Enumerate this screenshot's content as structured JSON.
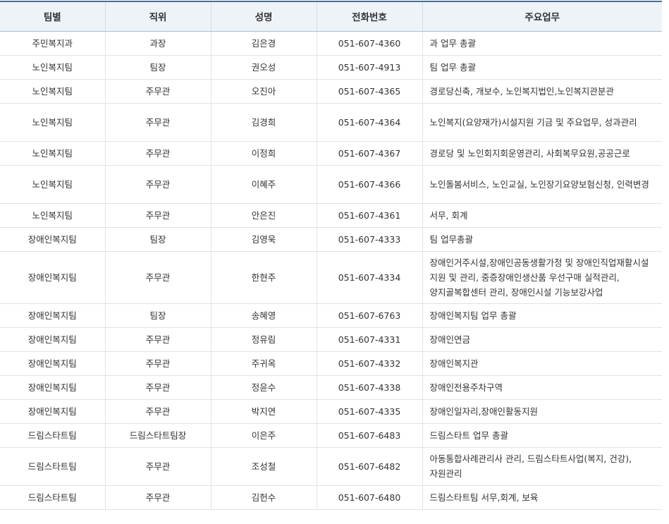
{
  "table": {
    "headers": [
      "팀별",
      "직위",
      "성명",
      "전화번호",
      "주요업무"
    ],
    "rows": [
      {
        "team": "주민복지과",
        "position": "과장",
        "name": "김은경",
        "phone": "051-607-4360",
        "duty": "과 업무 총괄"
      },
      {
        "team": "노인복지팀",
        "position": "팀장",
        "name": "권오성",
        "phone": "051-607-4913",
        "duty": "팀 업무 총괄"
      },
      {
        "team": "노인복지팀",
        "position": "주무관",
        "name": "오진아",
        "phone": "051-607-4365",
        "duty": "경로당신축, 개보수, 노인복지법인,노인복지관분관"
      },
      {
        "team": "노인복지팀",
        "position": "주무관",
        "name": "김경희",
        "phone": "051-607-4364",
        "duty": "노인복지(요양재가)시설지원 기금 및 주요업무, 성과관리"
      },
      {
        "team": "노인복지팀",
        "position": "주무관",
        "name": "이정희",
        "phone": "051-607-4367",
        "duty": "경로당 및 노인회지회운영관리, 사회복무요원,공공근로"
      },
      {
        "team": "노인복지팀",
        "position": "주무관",
        "name": "이혜주",
        "phone": "051-607-4366",
        "duty": "노인돌봄서비스, 노인교실, 노인장기요양보험신청, 인력변경"
      },
      {
        "team": "노인복지팀",
        "position": "주무관",
        "name": "안은진",
        "phone": "051-607-4361",
        "duty": "서무, 회계"
      },
      {
        "team": "장애인복지팀",
        "position": "팀장",
        "name": "김영욱",
        "phone": "051-607-4333",
        "duty": "팀 업무총괄"
      },
      {
        "team": "장애인복지팀",
        "position": "주무관",
        "name": "한현주",
        "phone": "051-607-4334",
        "duty": "장애인거주시설,장애인공동생활가정 및 장애인직업재활시설 지원 및 관리, 중증장애인생산품 우선구매 실적관리, 양지골복합센터 관리, 장애인시설 기능보강사업"
      },
      {
        "team": "장애인복지팀",
        "position": "팀장",
        "name": "송혜영",
        "phone": "051-607-6763",
        "duty": "장애인복지팀 업무 총괄"
      },
      {
        "team": "장애인복지팀",
        "position": "주무관",
        "name": "정유림",
        "phone": "051-607-4331",
        "duty": "장애인연금"
      },
      {
        "team": "장애인복지팀",
        "position": "주무관",
        "name": "주귀옥",
        "phone": "051-607-4332",
        "duty": "장애인복지관"
      },
      {
        "team": "장애인복지팀",
        "position": "주무관",
        "name": "정윤수",
        "phone": "051-607-4338",
        "duty": "장애인전용주차구역"
      },
      {
        "team": "장애인복지팀",
        "position": "주무관",
        "name": "박지연",
        "phone": "051-607-4335",
        "duty": "장애인일자리,장애인활동지원"
      },
      {
        "team": "드림스타트팀",
        "position": "드림스타트팀장",
        "name": "이은주",
        "phone": "051-607-6483",
        "duty": "드림스타트 업무 총괄"
      },
      {
        "team": "드림스타트팀",
        "position": "주무관",
        "name": "조성철",
        "phone": "051-607-6482",
        "duty": "아동통합사례관리사 관리, 드림스타트사업(복지, 건강), 자원관리"
      },
      {
        "team": "드림스타트팀",
        "position": "주무관",
        "name": "김헌수",
        "phone": "051-607-6480",
        "duty": "드림스타트팀 서무,회계, 보육"
      }
    ]
  }
}
